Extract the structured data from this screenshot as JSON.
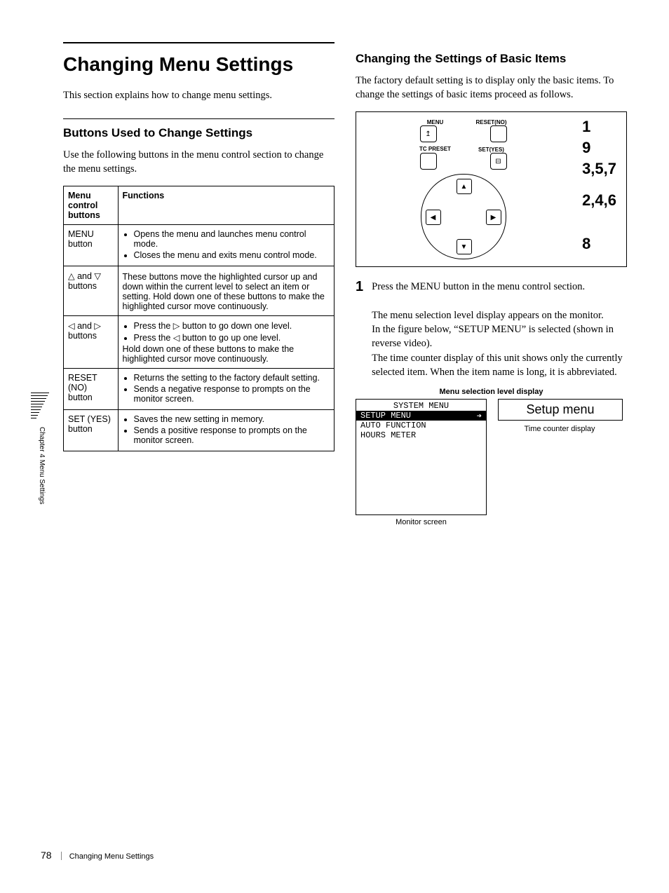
{
  "left": {
    "title": "Changing Menu Settings",
    "intro": "This section explains how to change menu settings.",
    "h2": "Buttons Used to Change Settings",
    "lead": "Use the following buttons in the menu control section to change the menu settings.",
    "table": {
      "head_a": "Menu control buttons",
      "head_b": "Functions",
      "rows": [
        {
          "name": "MENU button",
          "bullets": [
            "Opens the menu and launches menu control mode.",
            "Closes the menu and exits menu control mode."
          ],
          "tail": ""
        },
        {
          "name": "△ and ▽ buttons",
          "plain": "These buttons move the highlighted cursor up and down within the current level to select an item or setting. Hold down one of these buttons to make the highlighted cursor move continuously."
        },
        {
          "name": "◁ and ▷ buttons",
          "bullets": [
            "Press the ▷ button to go down one level.",
            "Press the ◁ button to go up one level."
          ],
          "tail": "Hold down one of these buttons to make the highlighted cursor move continuously."
        },
        {
          "name": "RESET (NO) button",
          "bullets": [
            "Returns the setting to the factory default setting.",
            "Sends a negative response to prompts on the monitor screen."
          ],
          "tail": ""
        },
        {
          "name": "SET (YES) button",
          "bullets": [
            "Saves the new setting in memory.",
            "Sends a positive response to prompts on the monitor screen."
          ],
          "tail": ""
        }
      ]
    }
  },
  "right": {
    "h2": "Changing the Settings of Basic Items",
    "lead": "The factory default setting is to display only the basic items. To change the settings of basic items proceed as follows.",
    "panel": {
      "lbl_menu": "MENU",
      "lbl_reset": "RESET(NO)",
      "lbl_tc": "TC PRESET",
      "lbl_set": "SET(YES)",
      "callouts": [
        "1",
        "9",
        "3,5,7",
        "2,4,6",
        "8"
      ]
    },
    "step_num": "1",
    "step_line1": "Press the MENU button in the menu control section.",
    "step_para": "The menu selection level display appears on the monitor.\nIn the figure below, “SETUP MENU” is selected (shown in reverse video).\nThe time counter display of this unit shows only the currently selected item. When the item name is long, it is abbreviated.",
    "sub_caption": "Menu selection level display",
    "monitor": {
      "line1": "SYSTEM MENU",
      "line2": "SETUP MENU",
      "line3": "AUTO FUNCTION",
      "line4": "HOURS METER"
    },
    "monitor_caption": "Monitor screen",
    "setup_box": "Setup menu",
    "tc_caption": "Time counter display"
  },
  "side_label": "Chapter 4  Menu Settings",
  "footer": {
    "page": "78",
    "title": "Changing Menu Settings"
  }
}
